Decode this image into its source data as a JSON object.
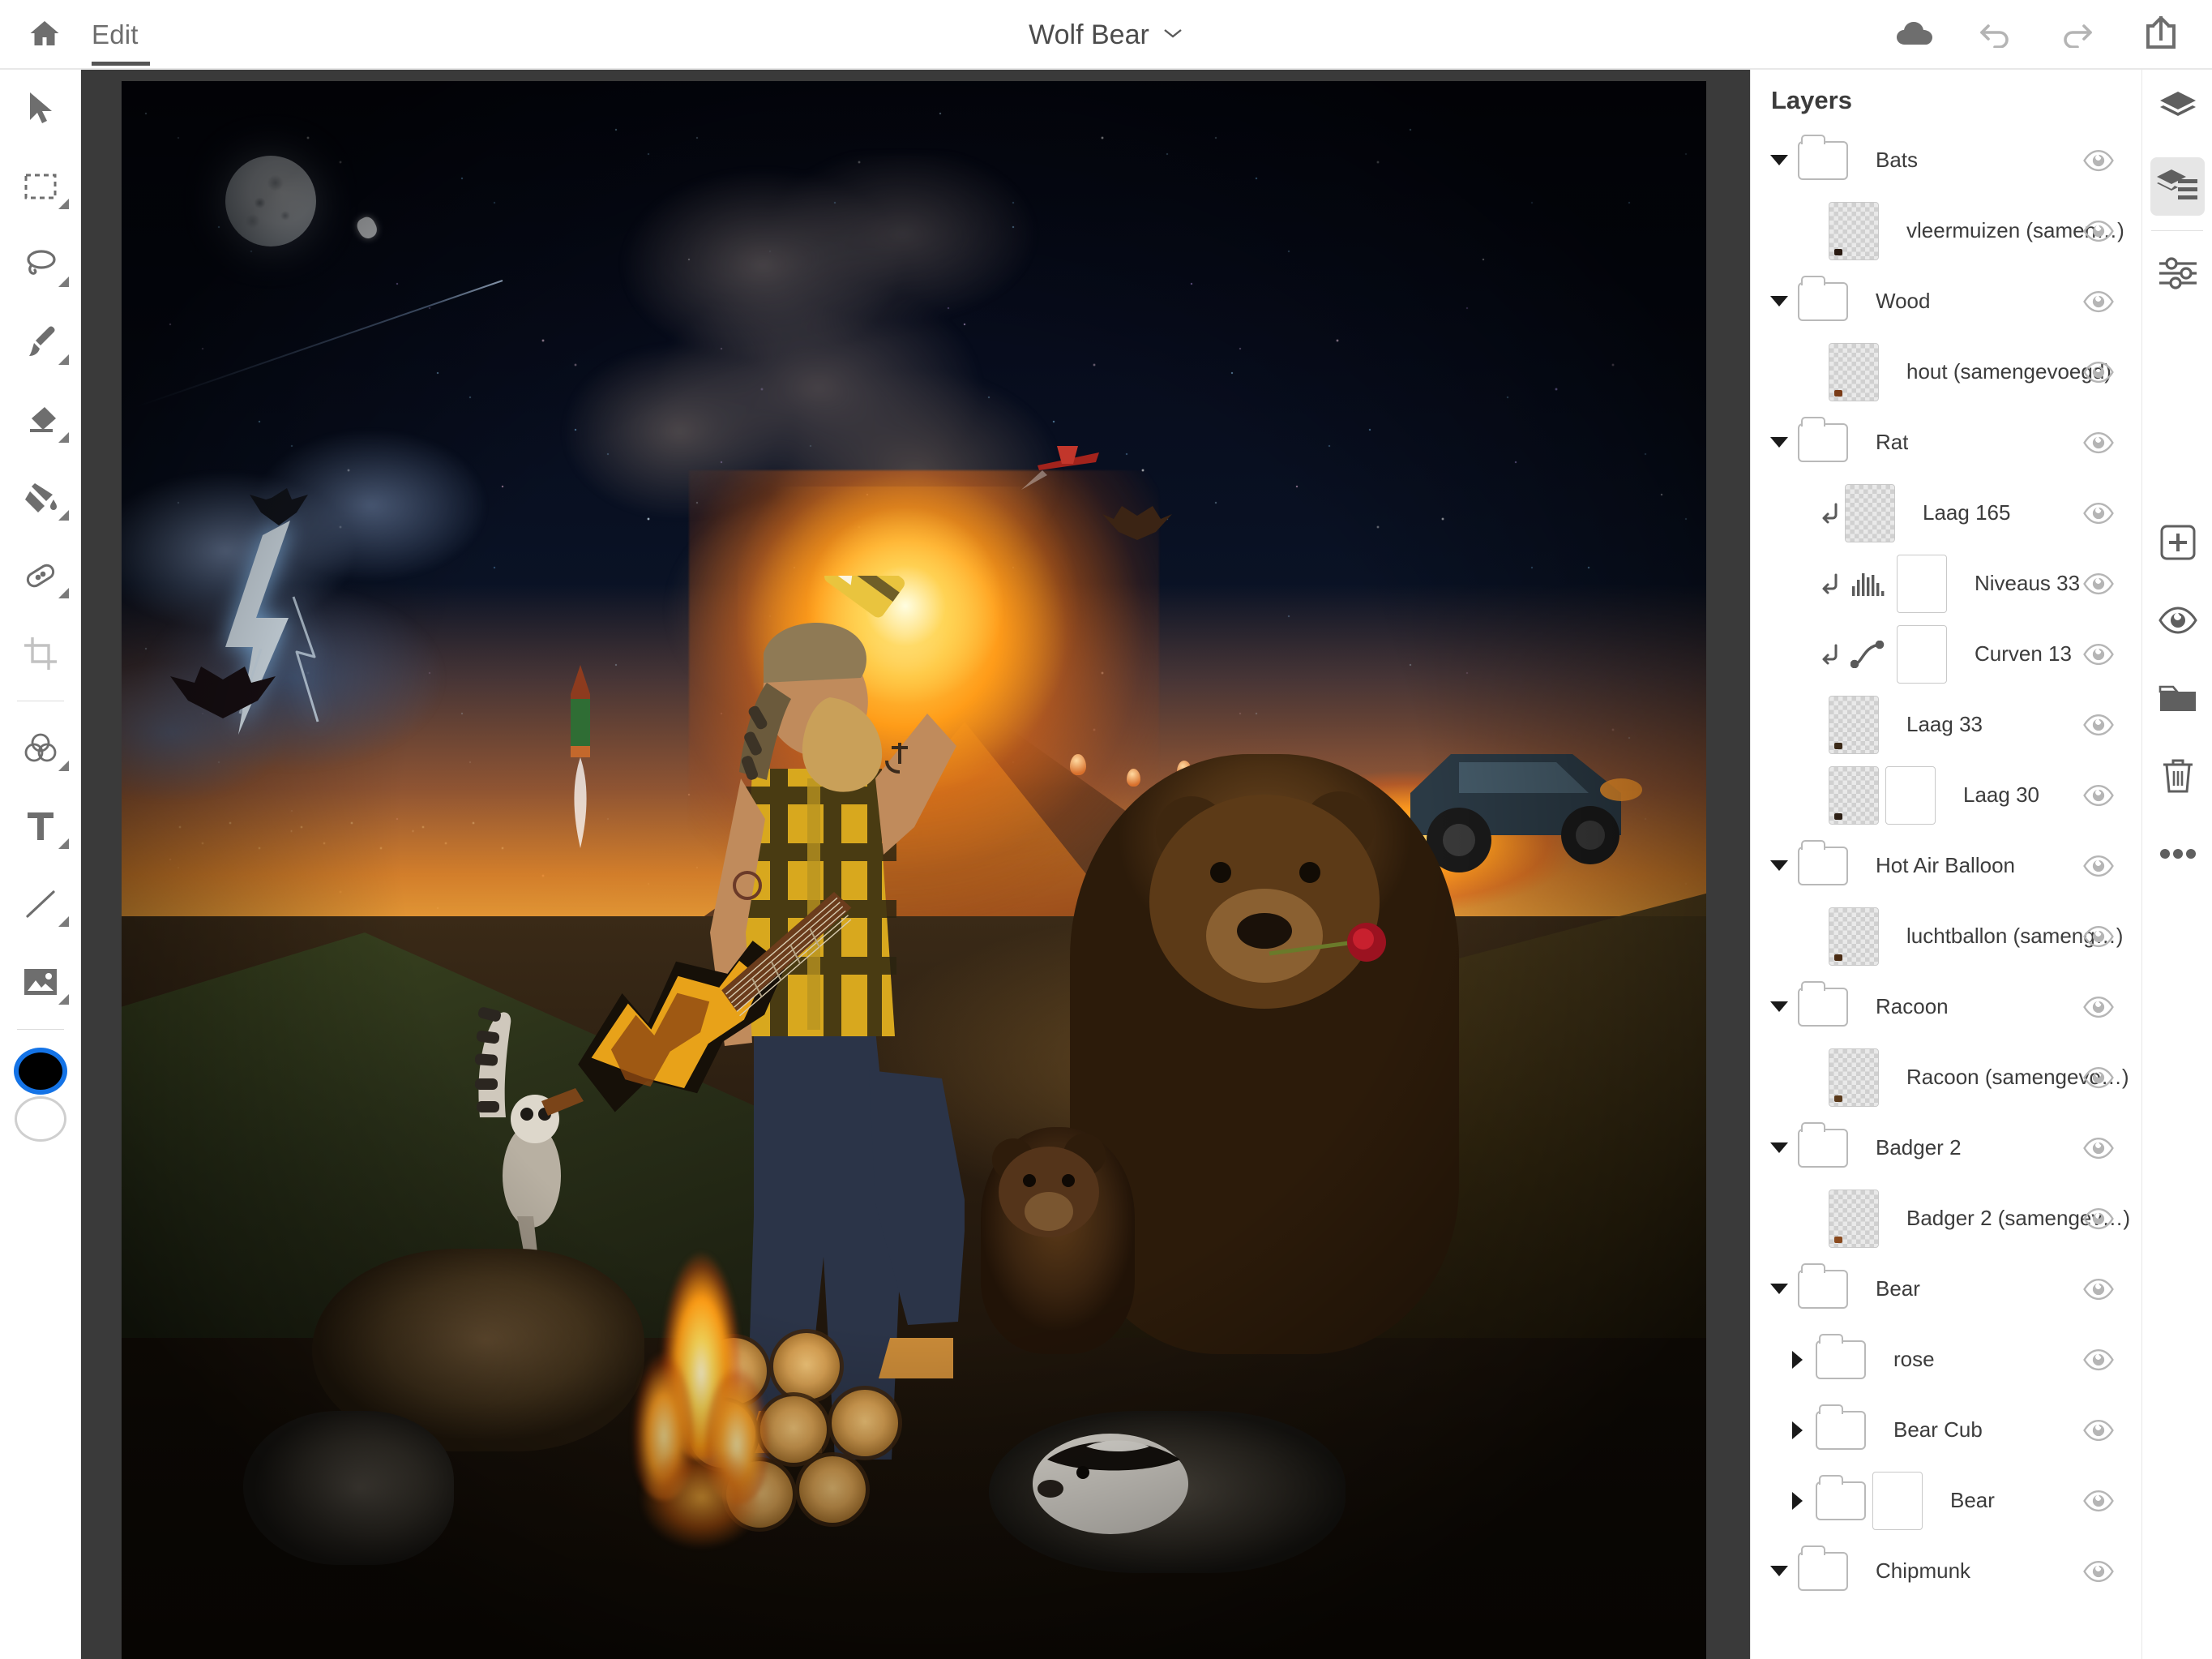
{
  "app": {
    "home_icon": "home-icon",
    "edit_tab_label": "Edit",
    "document_title": "Wolf Bear",
    "title_chevron": "⌄"
  },
  "topbar_actions": [
    {
      "name": "cloud-sync-icon",
      "label": "Cloud"
    },
    {
      "name": "undo-icon",
      "label": "Undo"
    },
    {
      "name": "redo-icon",
      "label": "Redo"
    },
    {
      "name": "share-icon",
      "label": "Share"
    }
  ],
  "toolbar": {
    "tools": [
      {
        "name": "move-tool",
        "label": "Move",
        "has_flyout": false
      },
      {
        "name": "transform-tool",
        "label": "Transform",
        "has_flyout": true
      },
      {
        "name": "lasso-select-tool",
        "label": "Lasso Select",
        "has_flyout": true
      },
      {
        "name": "brush-tool",
        "label": "Brush",
        "has_flyout": true
      },
      {
        "name": "eraser-tool",
        "label": "Eraser",
        "has_flyout": true
      },
      {
        "name": "paint-bucket-tool",
        "label": "Paint Bucket",
        "has_flyout": true
      },
      {
        "name": "healing-brush-tool",
        "label": "Healing Brush",
        "has_flyout": true
      },
      {
        "name": "crop-tool",
        "label": "Crop",
        "has_flyout": false
      },
      {
        "name": "color-adjust-tool",
        "label": "Color Adjust",
        "has_flyout": true
      },
      {
        "name": "type-tool",
        "label": "Type",
        "has_flyout": true
      },
      {
        "name": "line-tool",
        "label": "Line",
        "has_flyout": true
      },
      {
        "name": "place-image-tool",
        "label": "Place Image",
        "has_flyout": true
      }
    ],
    "foreground_color": "#000000",
    "background_color": "#ffffff",
    "selection_ring_color": "#1473e6"
  },
  "layers_panel": {
    "title": "Layers",
    "rows": [
      {
        "kind": "group",
        "indent": 0,
        "expanded": true,
        "name": "Bats",
        "visible": true,
        "has_mask": false,
        "clipped": false
      },
      {
        "kind": "layer",
        "indent": 1,
        "name": "vleermuizen (samen…)",
        "visible": true,
        "has_mask": false,
        "clipped": false,
        "thumb_tint": "#2a1b12"
      },
      {
        "kind": "group",
        "indent": 0,
        "expanded": true,
        "name": "Wood",
        "visible": true,
        "has_mask": false,
        "clipped": false
      },
      {
        "kind": "layer",
        "indent": 1,
        "name": "hout (samengevoegd)",
        "visible": true,
        "has_mask": false,
        "clipped": false,
        "thumb_tint": "#7a3c18"
      },
      {
        "kind": "group",
        "indent": 0,
        "expanded": true,
        "name": "Rat",
        "visible": true,
        "has_mask": false,
        "clipped": false
      },
      {
        "kind": "layer",
        "indent": 1,
        "name": "Laag 165",
        "visible": true,
        "has_mask": false,
        "clipped": true,
        "thumb_tint": "#00000000"
      },
      {
        "kind": "adjust",
        "indent": 1,
        "adjust_icon": "levels-icon",
        "name": "Niveaus 33",
        "visible": true,
        "has_mask": true,
        "clipped": true
      },
      {
        "kind": "adjust",
        "indent": 1,
        "adjust_icon": "curves-icon",
        "name": "Curven 13",
        "visible": true,
        "has_mask": true,
        "clipped": true
      },
      {
        "kind": "layer",
        "indent": 1,
        "name": "Laag 33",
        "visible": true,
        "has_mask": false,
        "clipped": false,
        "thumb_tint": "#3b2a18"
      },
      {
        "kind": "layer",
        "indent": 1,
        "name": "Laag 30",
        "visible": true,
        "has_mask": true,
        "clipped": false,
        "thumb_tint": "#2e2116"
      },
      {
        "kind": "group",
        "indent": 0,
        "expanded": true,
        "name": "Hot Air Balloon",
        "visible": true,
        "has_mask": false,
        "clipped": false
      },
      {
        "kind": "layer",
        "indent": 1,
        "name": "luchtballon (sameng…)",
        "visible": true,
        "has_mask": false,
        "clipped": false,
        "thumb_tint": "#4a2c14"
      },
      {
        "kind": "group",
        "indent": 0,
        "expanded": true,
        "name": "Racoon",
        "visible": true,
        "has_mask": false,
        "clipped": false
      },
      {
        "kind": "layer",
        "indent": 1,
        "name": "Racoon (samengevo…)",
        "visible": true,
        "has_mask": false,
        "clipped": false,
        "thumb_tint": "#5a3a1c"
      },
      {
        "kind": "group",
        "indent": 0,
        "expanded": true,
        "name": "Badger 2",
        "visible": true,
        "has_mask": false,
        "clipped": false
      },
      {
        "kind": "layer",
        "indent": 1,
        "name": "Badger 2 (samengev…)",
        "visible": true,
        "has_mask": false,
        "clipped": false,
        "thumb_tint": "#8a4a1e"
      },
      {
        "kind": "group",
        "indent": 0,
        "expanded": true,
        "name": "Bear",
        "visible": true,
        "has_mask": false,
        "clipped": false
      },
      {
        "kind": "group",
        "indent": 1,
        "expanded": false,
        "name": "rose",
        "visible": true,
        "has_mask": false,
        "clipped": false
      },
      {
        "kind": "group",
        "indent": 1,
        "expanded": false,
        "name": "Bear Cub",
        "visible": true,
        "has_mask": false,
        "clipped": false
      },
      {
        "kind": "group",
        "indent": 1,
        "expanded": false,
        "name": "Bear",
        "visible": true,
        "has_mask": true,
        "clipped": false
      },
      {
        "kind": "group",
        "indent": 0,
        "expanded": true,
        "name": "Chipmunk",
        "visible": true,
        "has_mask": false,
        "clipped": false
      }
    ],
    "visibility_icon": "eye-icon",
    "expanded_icon": "chevron-down-icon",
    "collapsed_icon": "chevron-right-icon",
    "clipping_icon": "clipping-mask-arrow-icon"
  },
  "right_rail": [
    {
      "name": "layers-stack-icon",
      "label": "Layer Comps",
      "active": false
    },
    {
      "name": "layers-list-icon",
      "label": "Layers",
      "active": true
    },
    {
      "name": "adjustments-sliders-icon",
      "label": "Adjustments",
      "active": false
    },
    {
      "name": "add-layer-icon",
      "label": "Add Layer",
      "active": false
    },
    {
      "name": "eye-icon",
      "label": "Toggle Visibility",
      "active": false
    },
    {
      "name": "folder-icon",
      "label": "New Group",
      "active": false
    },
    {
      "name": "trash-icon",
      "label": "Delete Layer",
      "active": false
    },
    {
      "name": "more-options-icon",
      "label": "More Options",
      "active": false
    }
  ],
  "canvas": {
    "background_color": "#3a3a3a",
    "artwork_description": "Composite photo illustration: bearded man in yellow plaid vest drinking a beer while holding a flame-painted electric guitar, erupting volcano behind, night sky with moon and astronaut, campfire, brown bear with rose, wolf, raccoons, lemur, badger, bear cub, hot air balloons, rocket, biplane and a truck on a ridge."
  }
}
